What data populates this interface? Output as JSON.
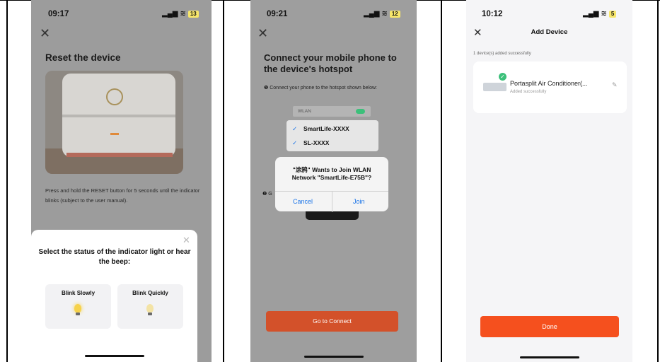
{
  "screen1": {
    "time": "09:17",
    "battery": "13",
    "title": "Reset the device",
    "description": "Press and hold the RESET button for 5 seconds until the indicator blinks (subject to the user manual).",
    "prompt": "Select the status of the indicator light or hear the beep:",
    "options": [
      {
        "label": "Blink Slowly",
        "bulb_color": "#f6d24a"
      },
      {
        "label": "Blink Quickly",
        "bulb_color": "#f3e3a5"
      }
    ]
  },
  "screen2": {
    "time": "09:21",
    "battery": "12",
    "title": "Connect your mobile phone to the device's hotspot",
    "step1": "❶ Connect your phone to the hotspot shown below:",
    "wlan_label": "WLAN",
    "networks": [
      "SmartLife-XXXX",
      "SL-XXXX"
    ],
    "step2_prefix": "❷ G",
    "alert": {
      "line1": "\"涂鸦\" Wants to Join WLAN",
      "line2": "Network \"SmartLife-E75B\"?",
      "cancel": "Cancel",
      "join": "Join"
    },
    "button": "Go to Connect"
  },
  "screen3": {
    "time": "10:12",
    "battery": "5",
    "header": "Add Device",
    "count": "1 device(s) added successfully",
    "device_name": "Portasplit Air Conditioner(...",
    "device_status": "Added successfully",
    "button": "Done"
  },
  "colors": {
    "accent_orange": "#f5501e",
    "connect_button": "#d3512a",
    "ios_blue": "#1a74e8",
    "success_green": "#3cc07a"
  }
}
